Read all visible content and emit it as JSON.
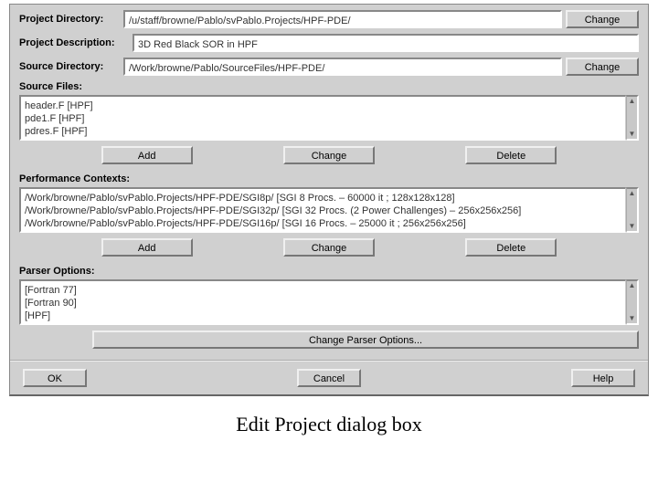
{
  "project_dir": {
    "label": "Project Directory:",
    "value": "/u/staff/browne/Pablo/svPablo.Projects/HPF-PDE/",
    "change": "Change"
  },
  "project_desc": {
    "label": "Project Description:",
    "value": "3D Red Black SOR in HPF"
  },
  "source_dir": {
    "label": "Source Directory:",
    "value": "/Work/browne/Pablo/SourceFiles/HPF-PDE/",
    "change": "Change"
  },
  "source_files": {
    "label": "Source Files:",
    "items": [
      "header.F [HPF]",
      "pde1.F [HPF]",
      "pdres.F [HPF]"
    ],
    "add": "Add",
    "chg": "Change",
    "del": "Delete"
  },
  "perf_contexts": {
    "label": "Performance Contexts:",
    "items": [
      "/Work/browne/Pablo/svPablo.Projects/HPF-PDE/SGI8p/ [SGI 8 Procs. – 60000 it ; 128x128x128]",
      "/Work/browne/Pablo/svPablo.Projects/HPF-PDE/SGI32p/ [SGI 32 Procs. (2 Power Challenges) – 256x256x256]",
      "/Work/browne/Pablo/svPablo.Projects/HPF-PDE/SGI16p/ [SGI 16 Procs. – 25000 it ; 256x256x256]"
    ],
    "add": "Add",
    "chg": "Change",
    "del": "Delete"
  },
  "parser": {
    "label": "Parser Options:",
    "items": [
      "[Fortran 77]",
      "[Fortran 90]",
      "[HPF]"
    ],
    "change_options": "Change Parser Options..."
  },
  "footer": {
    "ok": "OK",
    "cancel": "Cancel",
    "help": "Help"
  },
  "caption": "Edit Project dialog box"
}
